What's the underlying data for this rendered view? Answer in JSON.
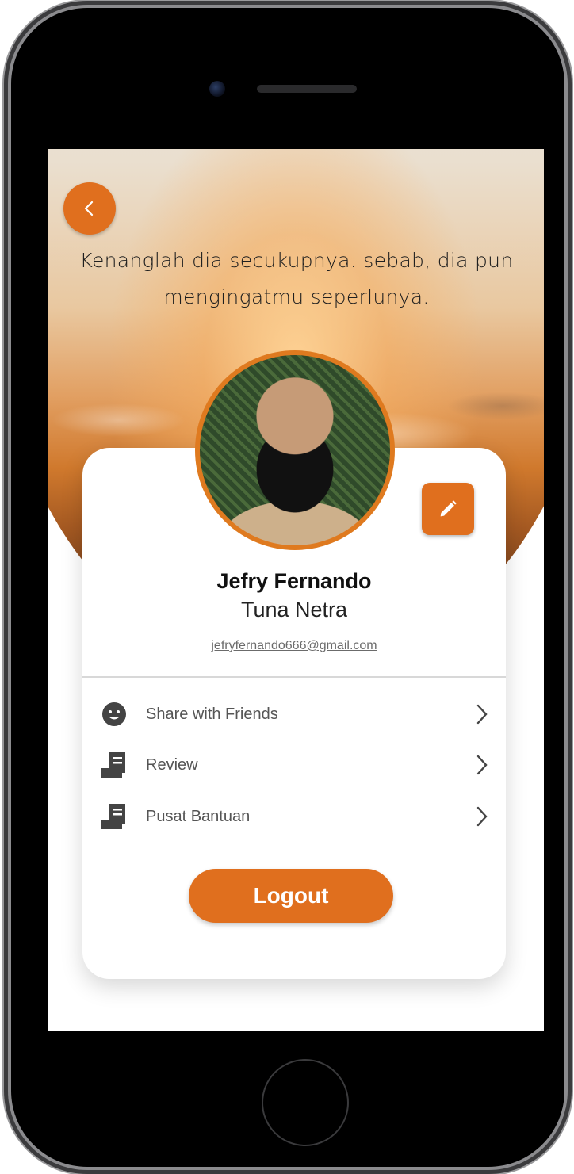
{
  "header": {
    "quote_line1": "Kenanglah dia secukupnya. sebab, dia pun",
    "quote_line2": "mengingatmu seperlunya."
  },
  "profile": {
    "name": "Jefry Fernando",
    "role": "Tuna Netra",
    "email": "jefryfernando666@gmail.com"
  },
  "menu": {
    "items": [
      {
        "label": "Share with Friends",
        "icon": "smiley-icon"
      },
      {
        "label": "Review",
        "icon": "document-icon"
      },
      {
        "label": "Pusat Bantuan",
        "icon": "document-icon"
      }
    ]
  },
  "actions": {
    "logout_label": "Logout"
  },
  "colors": {
    "accent": "#e06f1e",
    "ring": "#df7a1f",
    "text_dark": "#111111",
    "text_muted": "#555555"
  }
}
